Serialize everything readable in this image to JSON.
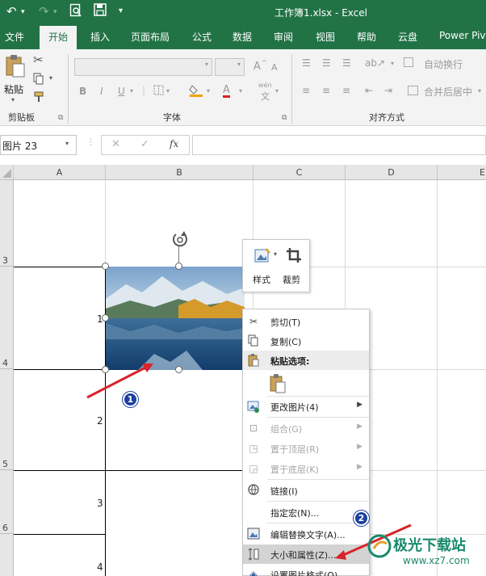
{
  "window": {
    "title": "工作簿1.xlsx  -  Excel"
  },
  "tabs": [
    "文件",
    "开始",
    "插入",
    "页面布局",
    "公式",
    "数据",
    "审阅",
    "视图",
    "帮助",
    "云盘",
    "Power Pivot"
  ],
  "ribbon": {
    "paste_label": "粘贴",
    "clipboard_label": "剪贴板",
    "font_label": "字体",
    "alignment_label": "对齐方式",
    "wrap_text": "自动换行",
    "merge_center": "合并后居中",
    "bold": "B",
    "italic": "I",
    "underline": "U",
    "font_grow": "A",
    "font_shrink": "A",
    "phonetic": "wén",
    "phonetic_char": "文",
    "font_color": "A"
  },
  "formula_bar": {
    "name_box": "图片 23",
    "cancel": "✕",
    "enter": "✓",
    "fx": "fx"
  },
  "columns": [
    "A",
    "B",
    "C",
    "D",
    "E"
  ],
  "rows": [
    "3",
    "4",
    "5",
    "6"
  ],
  "cells": {
    "b3": "1",
    "b4": "2",
    "b5": "3",
    "b6": "4"
  },
  "mini_toolbar": {
    "style": "样式",
    "crop": "裁剪"
  },
  "context_menu": {
    "cut": "剪切(T)",
    "copy": "复制(C)",
    "paste_options": "粘贴选项:",
    "change_picture": "更改图片(4)",
    "group": "组合(G)",
    "bring_front": "置于顶层(R)",
    "send_back": "置于底层(K)",
    "link": "链接(I)",
    "assign_macro": "指定宏(N)...",
    "edit_alt_text": "编辑替换文字(A)...",
    "size_properties": "大小和属性(Z)...",
    "format_picture": "设置图片格式(O)..."
  },
  "annotations": {
    "step1": "1",
    "step2": "2"
  },
  "watermark": {
    "text": "极光下载站",
    "url": "www.xz7.com"
  },
  "colors": {
    "excel_green": "#217346",
    "badge_blue": "#1c3f9e",
    "arrow_red": "#d8232a"
  }
}
